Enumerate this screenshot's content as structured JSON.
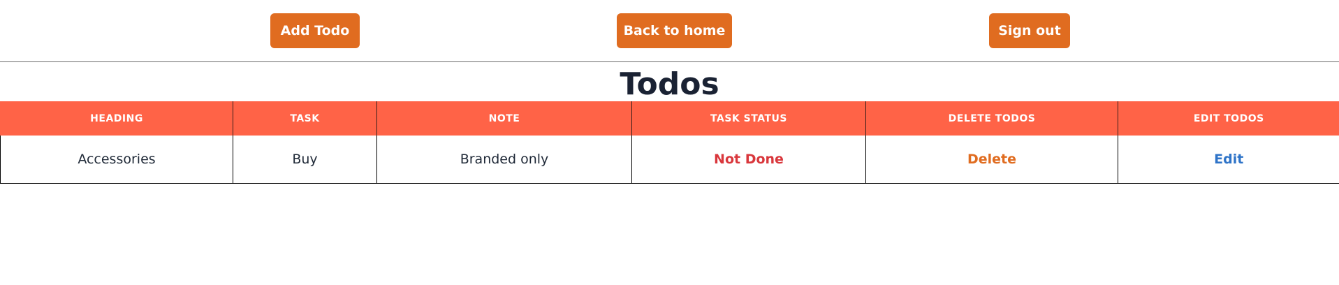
{
  "toolbar": {
    "add_label": "Add Todo",
    "home_label": "Back to home",
    "signout_label": "Sign out"
  },
  "page": {
    "title": "Todos"
  },
  "table": {
    "headers": [
      "HEADING",
      "TASK",
      "NOTE",
      "TASK STATUS",
      "DELETE TODOS",
      "EDIT TODOS"
    ],
    "rows": [
      {
        "heading": "Accessories",
        "task": "Buy",
        "note": "Branded only",
        "status": "Not Done",
        "delete": "Delete",
        "edit": "Edit"
      }
    ]
  },
  "colors": {
    "button_bg": "#e06c20",
    "header_bg": "#ff6347",
    "status_not_done": "#d9373c",
    "delete_link": "#e06c20",
    "edit_link": "#2f74c8"
  }
}
